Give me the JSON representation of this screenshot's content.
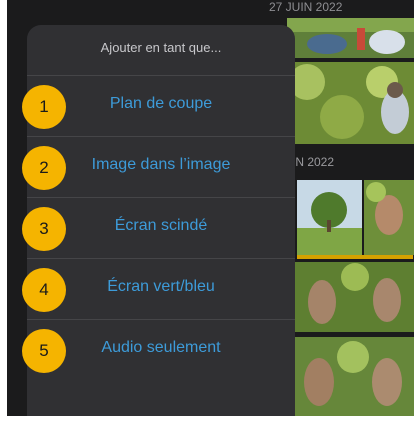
{
  "background": {
    "section_header_top": "27 JUIN 2022",
    "section_header_mid": "IN 2022"
  },
  "menu": {
    "title": "Ajouter en tant que...",
    "items": [
      {
        "badge": "1",
        "label": "Plan de coupe"
      },
      {
        "badge": "2",
        "label": "Image dans l’image"
      },
      {
        "badge": "3",
        "label": "Écran scindé"
      },
      {
        "badge": "4",
        "label": "Écran vert/bleu"
      },
      {
        "badge": "5",
        "label": "Audio seulement"
      }
    ]
  },
  "colors": {
    "menu_text": "#3d9bd9",
    "badge": "#f5b400",
    "panel": "#303033"
  }
}
